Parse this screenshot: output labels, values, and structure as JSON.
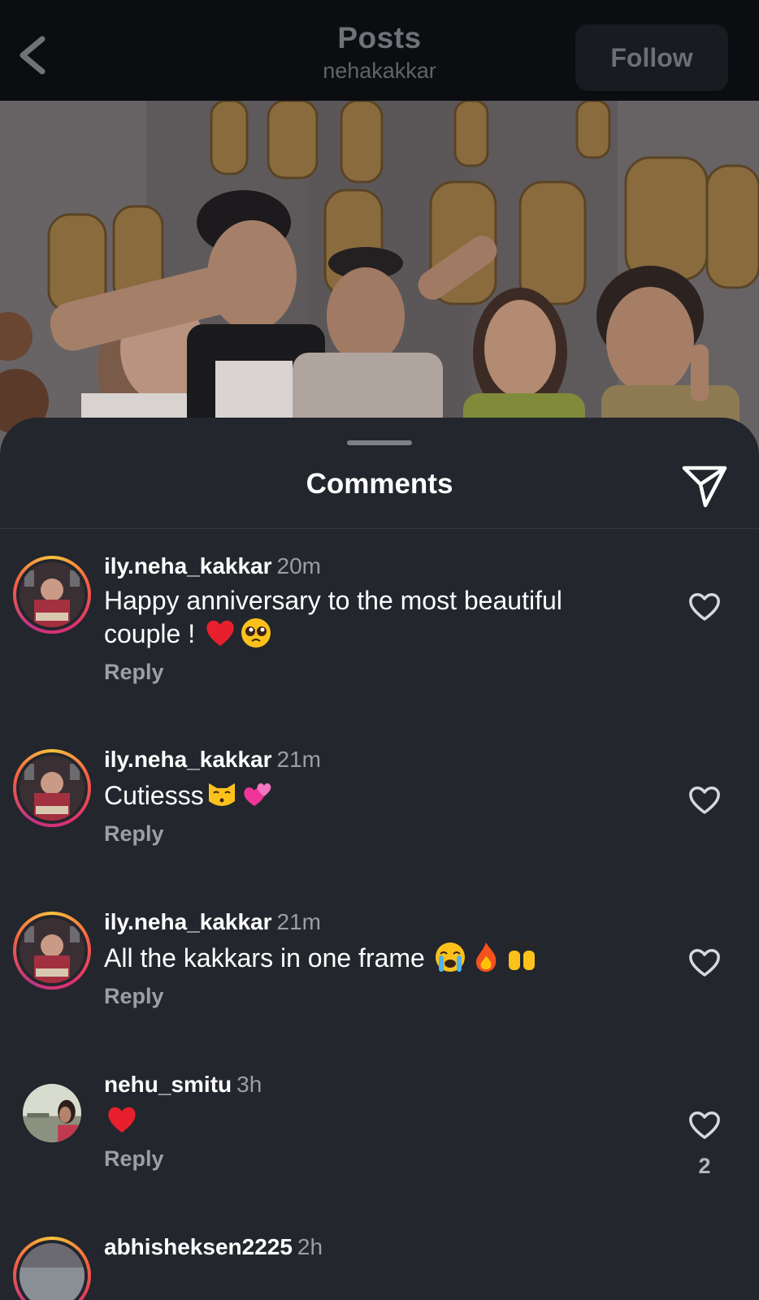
{
  "header": {
    "title": "Posts",
    "subtitle": "nehakakkar",
    "follow_label": "Follow"
  },
  "comments_sheet": {
    "title": "Comments"
  },
  "comments": [
    {
      "username": "ily.neha_kakkar",
      "time": "20m",
      "text_line1": "Happy anniversary to the most beautiful",
      "text_line2": "couple ! ",
      "emojis": [
        "red-heart",
        "pleading-face"
      ],
      "reply_label": "Reply"
    },
    {
      "username": "ily.neha_kakkar",
      "time": "21m",
      "text": "Cutiesss",
      "emojis": [
        "kissing-cat",
        "two-hearts"
      ],
      "reply_label": "Reply"
    },
    {
      "username": "ily.neha_kakkar",
      "time": "21m",
      "text": "All the kakkars in one frame ",
      "emojis": [
        "crying-face",
        "fire",
        "raising-hands"
      ],
      "reply_label": "Reply"
    },
    {
      "username": "nehu_smitu",
      "time": "3h",
      "text": "",
      "emojis": [
        "red-heart"
      ],
      "reply_label": "Reply",
      "like_count": "2"
    },
    {
      "username": "abhisheksen2225",
      "time": "2h"
    }
  ],
  "colors": {
    "background": "#0e1116",
    "sheet": "#23262c",
    "story_ring_start": "#f9c23c",
    "story_ring_end": "#c13584"
  }
}
